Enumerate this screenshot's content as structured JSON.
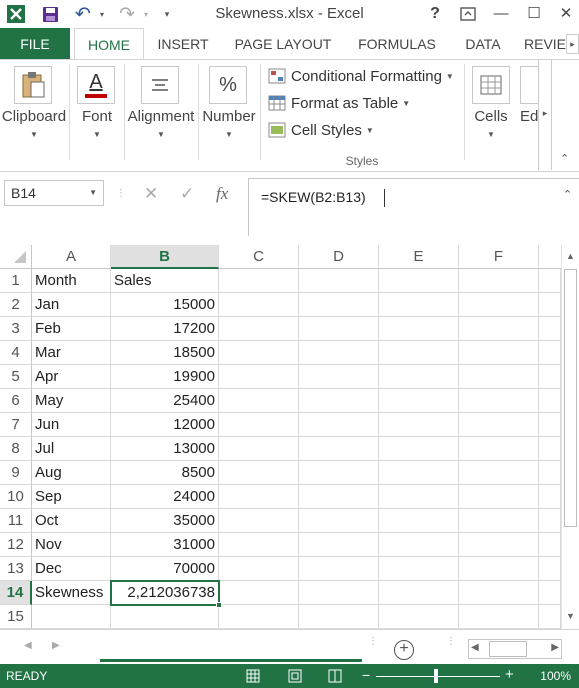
{
  "window": {
    "title": "Skewness.xlsx - Excel",
    "help": "?",
    "restore": "⧉",
    "minimize": "—",
    "maximize": "☐",
    "close": "✕"
  },
  "quick_access": {
    "undo_glyph": "↶",
    "redo_glyph": "↷",
    "customize_glyph": "▾"
  },
  "tabs": [
    "FILE",
    "HOME",
    "INSERT",
    "PAGE LAYOUT",
    "FORMULAS",
    "DATA",
    "REVIE"
  ],
  "ribbon": {
    "clipboard": "Clipboard",
    "font": "Font",
    "font_icon_letter": "A",
    "alignment": "Alignment",
    "number": "Number",
    "number_icon": "%",
    "conditional_formatting": "Conditional Formatting",
    "format_as_table": "Format as Table",
    "cell_styles": "Cell Styles",
    "styles_group": "Styles",
    "cells": "Cells",
    "editing": "Ed"
  },
  "formula_bar": {
    "name_box": "B14",
    "formula": "=SKEW(B2:B13)",
    "fx": "fx"
  },
  "columns": [
    "A",
    "B",
    "C",
    "D",
    "E",
    "F"
  ],
  "rows": [
    {
      "num": "1",
      "a": "Month",
      "b": "Sales"
    },
    {
      "num": "2",
      "a": "Jan",
      "b": "15000"
    },
    {
      "num": "3",
      "a": "Feb",
      "b": "17200"
    },
    {
      "num": "4",
      "a": "Mar",
      "b": "18500"
    },
    {
      "num": "5",
      "a": "Apr",
      "b": "19900"
    },
    {
      "num": "6",
      "a": "May",
      "b": "25400"
    },
    {
      "num": "7",
      "a": "Jun",
      "b": "12000"
    },
    {
      "num": "8",
      "a": "Jul",
      "b": "13000"
    },
    {
      "num": "9",
      "a": "Aug",
      "b": "8500"
    },
    {
      "num": "10",
      "a": "Sep",
      "b": "24000"
    },
    {
      "num": "11",
      "a": "Oct",
      "b": "35000"
    },
    {
      "num": "12",
      "a": "Nov",
      "b": "31000"
    },
    {
      "num": "13",
      "a": "Dec",
      "b": "70000"
    },
    {
      "num": "14",
      "a": "Skewness",
      "b": "2,212036738"
    },
    {
      "num": "15",
      "a": "",
      "b": ""
    }
  ],
  "status": {
    "ready": "READY",
    "zoom": "100%",
    "zoom_minus": "−",
    "zoom_plus": "+"
  },
  "colors": {
    "accent": "#217346",
    "header_active": "#e1e1e1"
  }
}
